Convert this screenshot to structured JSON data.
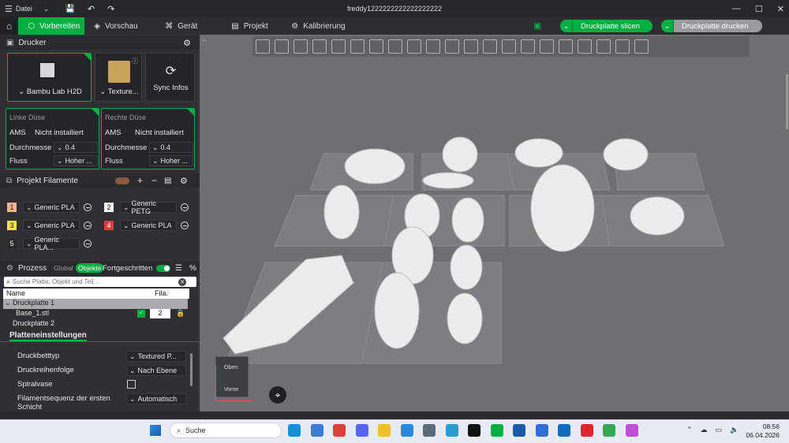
{
  "titlebar": {
    "file_menu": "Datei",
    "window_title": "freddy1222222222222222222"
  },
  "tabs": [
    {
      "label": "Vorbereiten"
    },
    {
      "label": "Vorschau"
    },
    {
      "label": "Gerät"
    },
    {
      "label": "Projekt"
    },
    {
      "label": "Kalibrierung"
    }
  ],
  "actions": {
    "slice": "Druckplatte slicen",
    "print": "Druckplatte drucken"
  },
  "printer": {
    "section": "Drucker",
    "name": "Bambu Lab H2D",
    "plate": "Texture...",
    "sync": "Sync Infos"
  },
  "nozzles": {
    "left": {
      "title": "Linke Düse",
      "ams_label": "AMS",
      "ams_value": "Nicht installiert",
      "diameter_label": "Durchmesse",
      "diameter_value": "0.4",
      "flow_label": "Fluss",
      "flow_value": "Hoher ..."
    },
    "right": {
      "title": "Rechte Düse",
      "ams_label": "AMS",
      "ams_value": "Nicht installiert",
      "diameter_label": "Durchmesse",
      "diameter_value": "0.4",
      "flow_label": "Fluss",
      "flow_value": "Hoher ..."
    }
  },
  "filaments": {
    "section": "Projekt Filamente",
    "items": [
      {
        "num": "1",
        "name": "Generic PLA",
        "color": "#f2b48a"
      },
      {
        "num": "2",
        "name": "Generic PETG",
        "color": "#f2f2f2"
      },
      {
        "num": "3",
        "name": "Generic PLA",
        "color": "#f5e43a"
      },
      {
        "num": "4",
        "name": "Generic PLA",
        "color": "#e03c3c"
      },
      {
        "num": "5",
        "name": "Generic PLA...",
        "color": "#2a2a2a"
      }
    ]
  },
  "process": {
    "section": "Prozess",
    "global": "Global",
    "objects": "Objekte",
    "advanced": "Fortgeschritten",
    "search_placeholder": "Suche Platte, Objekt und Teil...",
    "col_name": "Name",
    "col_fila": "Fila.",
    "tree": [
      {
        "label": "Druckplatte 1"
      },
      {
        "label": "Base_1.stl",
        "fila": "2"
      },
      {
        "label": "Druckplatte 2"
      }
    ]
  },
  "plate_settings": {
    "title": "Platteneinstellungen",
    "rows": [
      {
        "label": "Druckbetttyp",
        "value": "Textured P..."
      },
      {
        "label": "Druckreihenfolge",
        "value": "Nach Ebene"
      },
      {
        "label": "Spiralvase",
        "value": ""
      },
      {
        "label": "Filamentsequenz der ersten Schicht",
        "value": "Automatisch"
      }
    ]
  },
  "viewcube": {
    "top": "Oben",
    "front": "Vorne"
  },
  "taskbar": {
    "search": "Suche",
    "time": "08:56",
    "date": "06.04.2026"
  },
  "colors": {
    "accent": "#00ae42",
    "viewport": "#6e6f73",
    "panel": "#2f3034"
  }
}
